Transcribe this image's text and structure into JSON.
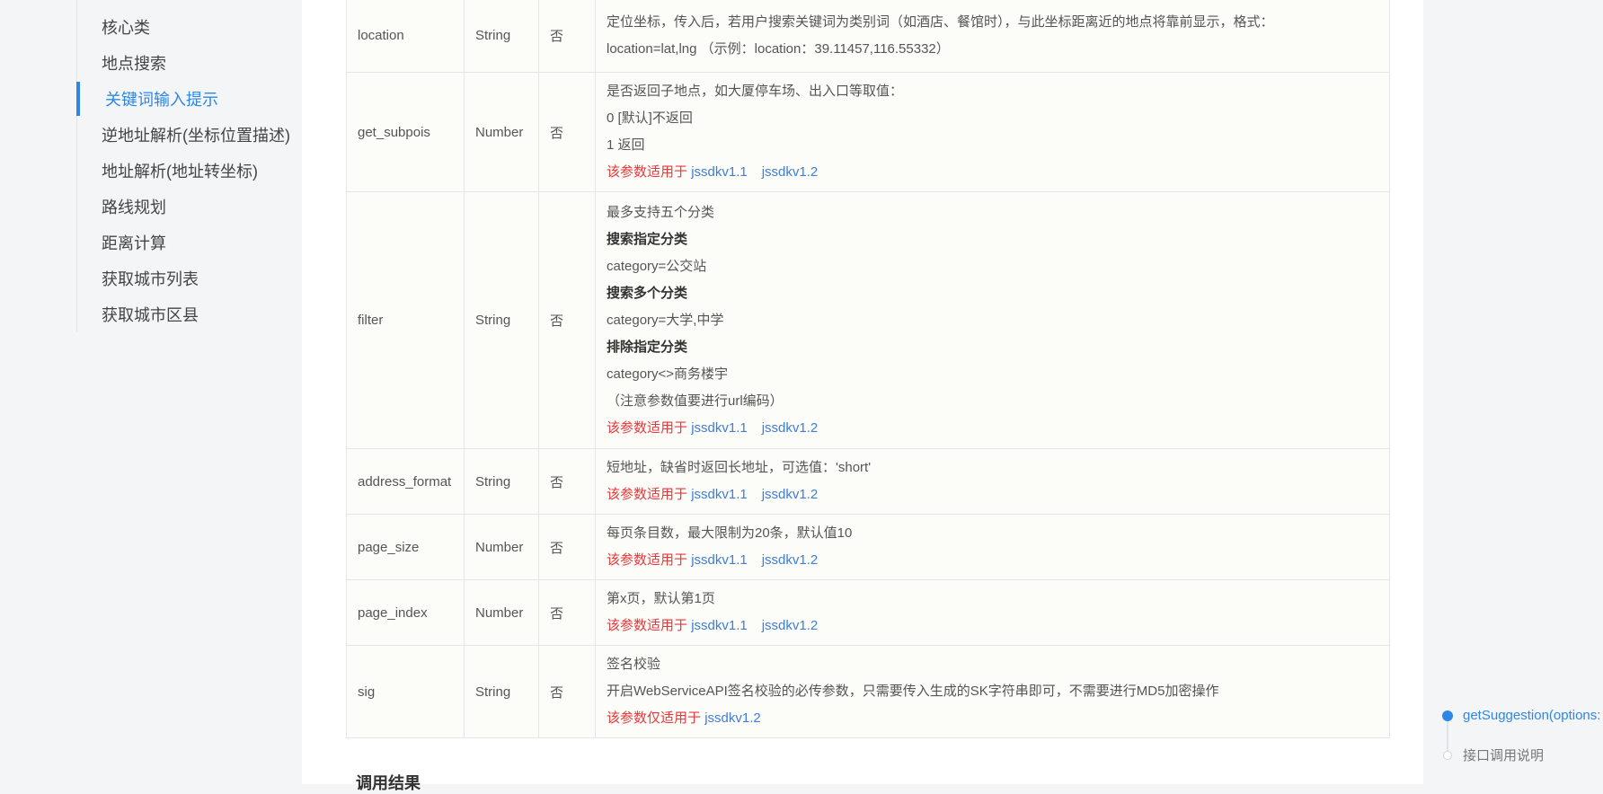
{
  "sidebar": {
    "items": [
      {
        "label": "核心类"
      },
      {
        "label": "地点搜索"
      },
      {
        "label": "关键词输入提示"
      },
      {
        "label": "逆地址解析(坐标位置描述)"
      },
      {
        "label": "地址解析(地址转坐标)"
      },
      {
        "label": "路线规划"
      },
      {
        "label": "距离计算"
      },
      {
        "label": "获取城市列表"
      },
      {
        "label": "获取城市区县"
      }
    ],
    "active_index": 2
  },
  "params_table": {
    "rows": [
      {
        "name": "location",
        "type": "String",
        "required": "否",
        "desc": [
          "定位坐标，传入后，若用户搜索关键词为类别词（如酒店、餐馆时），与此坐标距离近的地点将靠前显示，格式：",
          "location=lat,lng （示例：location：39.11457,116.55332）"
        ]
      },
      {
        "name": "get_subpois",
        "type": "Number",
        "required": "否",
        "desc": [
          "是否返回子地点，如大厦停车场、出入口等取值：",
          "0 [默认]不返回",
          "1 返回"
        ],
        "applies_label": "该参数适用于",
        "versions": [
          "jssdkv1.1",
          "jssdkv1.2"
        ]
      },
      {
        "name": "filter",
        "type": "String",
        "required": "否",
        "desc": [
          "最多支持五个分类",
          "搜索指定分类",
          "category=公交站",
          "搜索多个分类",
          "category=大学,中学",
          "排除指定分类",
          "category<>商务楼宇",
          "（注意参数值要进行url编码）"
        ],
        "applies_label": "该参数适用于",
        "versions": [
          "jssdkv1.1",
          "jssdkv1.2"
        ]
      },
      {
        "name": "address_format",
        "type": "String",
        "required": "否",
        "desc": [
          "短地址，缺省时返回长地址，可选值：'short'"
        ],
        "applies_label": "该参数适用于",
        "versions": [
          "jssdkv1.1",
          "jssdkv1.2"
        ]
      },
      {
        "name": "page_size",
        "type": "Number",
        "required": "否",
        "desc": [
          "每页条目数，最大限制为20条，默认值10"
        ],
        "applies_label": "该参数适用于",
        "versions": [
          "jssdkv1.1",
          "jssdkv1.2"
        ]
      },
      {
        "name": "page_index",
        "type": "Number",
        "required": "否",
        "desc": [
          "第x页，默认第1页"
        ],
        "applies_label": "该参数适用于",
        "versions": [
          "jssdkv1.1",
          "jssdkv1.2"
        ]
      },
      {
        "name": "sig",
        "type": "String",
        "required": "否",
        "desc": [
          "签名校验",
          "开启WebServiceAPI签名校验的必传参数，只需要传入生成的SK字符串即可，不需要进行MD5加密操作"
        ],
        "applies_label": "该参数仅适用于",
        "versions": [
          "jssdkv1.2"
        ]
      }
    ]
  },
  "section": {
    "title": "调用结果"
  },
  "toc": {
    "items": [
      {
        "label": "getSuggestion(options:"
      },
      {
        "label": "接口调用说明"
      }
    ]
  },
  "colors": {
    "accent": "#2e87e8",
    "warning_red": "#e8373a",
    "link_blue": "#3f7dd6"
  }
}
